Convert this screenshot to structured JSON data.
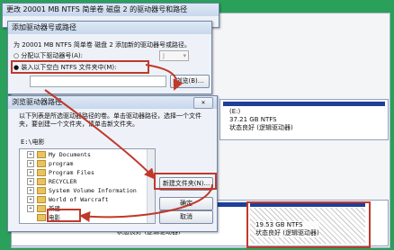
{
  "disk_mgmt": {
    "volume_e": {
      "name": "(E:)",
      "size": "37.21 GB NTFS",
      "status": "状态良好 (逻辑驱动器)"
    },
    "new_volume": {
      "size": "19.53 GB NTFS",
      "status": "状态良好 (逻辑驱动器)"
    },
    "row_status_left": "状态良好 (逻辑驱动器)"
  },
  "change_dialog": {
    "title": "更改 20001 MB NTFS 简单卷 磁盘 2 的驱动器号和路径"
  },
  "add_dialog": {
    "title": "添加驱动器号或路径",
    "description": "为 20001 MB NTFS 简单卷 磁盘 2 添加新的驱动器号或路径。",
    "option_letter": "分配以下驱动器号(A):",
    "option_folder": "装入以下空白 NTFS 文件夹中(M):",
    "letter_value": "J",
    "browse_label": "浏览(B)..."
  },
  "browse_dialog": {
    "title": "浏览驱动器路径",
    "help": "以下列表是所选驱动器路径的卷。单击驱动器路径，选择一个文件夹，要创建一个文件夹，请单击新文件夹。",
    "path": "E:\\电影",
    "folders": [
      "My Documents",
      "program",
      "Program Files",
      "RECYCLER",
      "System Volume Information",
      "World of Warcraft",
      "新建",
      "电影"
    ],
    "new_folder": "新建文件夹(N)...",
    "ok": "确定",
    "cancel": "取消"
  },
  "colors": {
    "highlight": "#c0392b",
    "volume_header": "#1e3f9a"
  }
}
